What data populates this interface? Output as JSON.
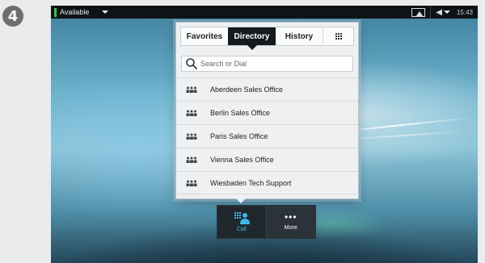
{
  "step": {
    "number": "4"
  },
  "status_bar": {
    "presence": "Available",
    "presence_color": "#3cc241",
    "clock": "15:43",
    "icons": [
      "selfview-icon",
      "speaker-icon",
      "chevron-down-icon"
    ]
  },
  "directory_panel": {
    "tabs": [
      {
        "label": "Favorites",
        "active": false
      },
      {
        "label": "Directory",
        "active": true
      },
      {
        "label": "History",
        "active": false
      },
      {
        "label": "",
        "icon": "keypad-icon",
        "active": false
      }
    ],
    "search": {
      "placeholder": "Search or Dial",
      "value": ""
    },
    "entries": [
      {
        "label": "Aberdeen Sales Office",
        "icon": "group-icon"
      },
      {
        "label": "Berlin Sales Office",
        "icon": "group-icon"
      },
      {
        "label": "Paris Sales Office",
        "icon": "group-icon"
      },
      {
        "label": "Vienna Sales Office",
        "icon": "group-icon"
      },
      {
        "label": "Wiesbaden Tech Support",
        "icon": "group-icon"
      }
    ]
  },
  "dock": {
    "call_label": "Call",
    "more_label": "More",
    "more_glyph": "•••",
    "accent_color": "#3fb8e8"
  }
}
